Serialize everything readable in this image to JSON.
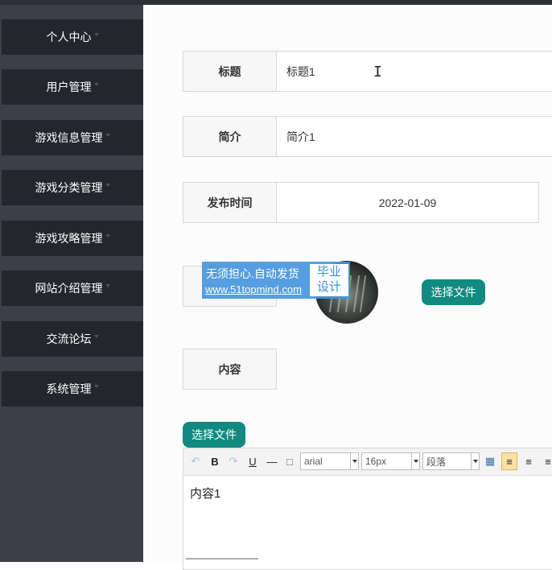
{
  "sidebar": {
    "items": [
      {
        "label": "个人中心"
      },
      {
        "label": "用户管理"
      },
      {
        "label": "游戏信息管理"
      },
      {
        "label": "游戏分类管理"
      },
      {
        "label": "游戏攻略管理"
      },
      {
        "label": "网站介绍管理"
      },
      {
        "label": "交流论坛"
      },
      {
        "label": "系统管理"
      }
    ]
  },
  "form": {
    "title_label": "标题",
    "title_value": "标题1",
    "intro_label": "简介",
    "intro_value": "简介1",
    "date_label": "发布时间",
    "date_value": "2022-01-09",
    "image_button": "选择文件",
    "content_label": "内容",
    "content_file_button": "选择文件"
  },
  "watermark": {
    "line1": "无须担心.自动发货",
    "line2": "www.51topmind.com",
    "badge_line1": "毕业",
    "badge_line2": "设计"
  },
  "editor": {
    "font_family": "arial",
    "font_size": "16px",
    "paragraph": "段落",
    "content": "内容1",
    "icons": [
      "undo-icon",
      "bold-icon",
      "redo-icon",
      "underline-icon",
      "horizontal-rule-icon",
      "document-icon",
      "table-icon",
      "align-left-icon",
      "align-center-icon",
      "align-right-icon"
    ]
  },
  "colors": {
    "sidebar_bg": "#3a3f48",
    "sidebar_item_bg": "#23262c",
    "accent": "#128a80",
    "watermark_bg": "#4696dc"
  }
}
